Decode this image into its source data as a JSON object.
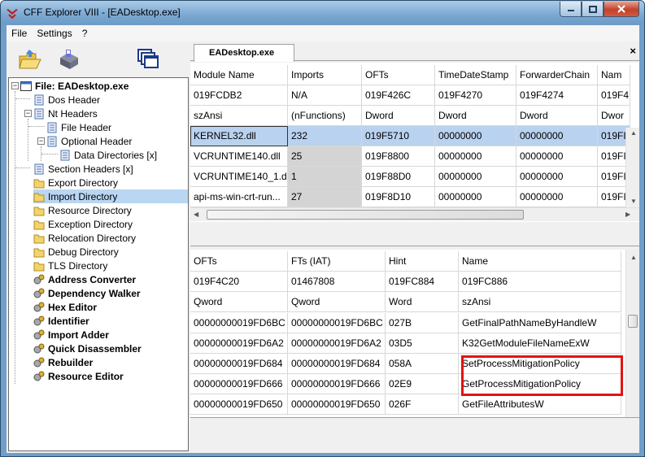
{
  "window": {
    "title": "CFF Explorer VIII - [EADesktop.exe]",
    "accent": "#6f9ec9",
    "close_color": "#c4412b"
  },
  "menu": [
    "File",
    "Settings",
    "?"
  ],
  "toolbar": {
    "icons": [
      "open-folder-icon",
      "save-disk-icon",
      "windows-icon"
    ]
  },
  "tree": {
    "root": "File: EADesktop.exe",
    "items": [
      "Dos Header",
      "Nt Headers",
      "File Header",
      "Optional Header",
      "Data Directories [x]",
      "Section Headers [x]",
      "Export Directory",
      "Import Directory",
      "Resource Directory",
      "Exception Directory",
      "Relocation Directory",
      "Debug Directory",
      "TLS Directory"
    ],
    "tools": [
      "Address Converter",
      "Dependency Walker",
      "Hex Editor",
      "Identifier",
      "Import Adder",
      "Quick Disassembler",
      "Rebuilder",
      "Resource Editor"
    ]
  },
  "tab": {
    "label": "EADesktop.exe",
    "close": "×"
  },
  "modules": {
    "headers": [
      "Module Name",
      "Imports",
      "OFTs",
      "TimeDateStamp",
      "ForwarderChain",
      "Nam"
    ],
    "offsets": [
      "019FCDB2",
      "N/A",
      "019F426C",
      "019F4270",
      "019F4274",
      "019F4"
    ],
    "types": [
      "szAnsi",
      "(nFunctions)",
      "Dword",
      "Dword",
      "Dword",
      "Dwor"
    ],
    "rows": [
      [
        "KERNEL32.dll",
        "232",
        "019F5710",
        "00000000",
        "00000000",
        "019FI"
      ],
      [
        "VCRUNTIME140.dll",
        "25",
        "019F8800",
        "00000000",
        "00000000",
        "019FI"
      ],
      [
        "VCRUNTIME140_1.dll",
        "1",
        "019F88D0",
        "00000000",
        "00000000",
        "019FI"
      ],
      [
        "api-ms-win-crt-run...",
        "27",
        "019F8D10",
        "00000000",
        "00000000",
        "019FI"
      ]
    ]
  },
  "functions": {
    "headers": [
      "OFTs",
      "FTs (IAT)",
      "Hint",
      "Name"
    ],
    "offsets": [
      "019F4C20",
      "01467808",
      "019FC884",
      "019FC886"
    ],
    "types": [
      "Qword",
      "Qword",
      "Word",
      "szAnsi"
    ],
    "rows": [
      [
        "00000000019FD6BC",
        "00000000019FD6BC",
        "027B",
        "GetFinalPathNameByHandleW"
      ],
      [
        "00000000019FD6A2",
        "00000000019FD6A2",
        "03D5",
        "K32GetModuleFileNameExW"
      ],
      [
        "00000000019FD684",
        "00000000019FD684",
        "058A",
        "SetProcessMitigationPolicy"
      ],
      [
        "00000000019FD666",
        "00000000019FD666",
        "02E9",
        "GetProcessMitigationPolicy"
      ],
      [
        "00000000019FD650",
        "00000000019FD650",
        "026F",
        "GetFileAttributesW"
      ]
    ]
  },
  "highlight_color": "#e31313"
}
